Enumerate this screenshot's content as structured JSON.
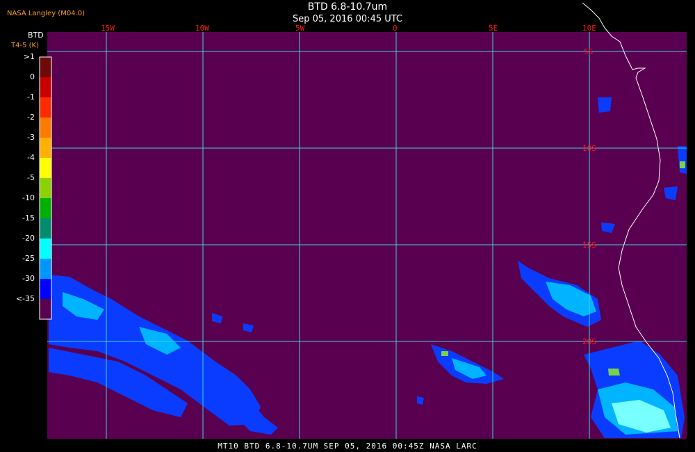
{
  "header": {
    "source": "NASA Langley (M04.0)",
    "title": "BTD 6.8-10.7um",
    "datetime": "Sep 05, 2016 00:45 UTC"
  },
  "legend": {
    "title": "BTD",
    "subtitle": "T4-5 (K)",
    "ticks": [
      ">1",
      "0",
      "-1",
      "-2",
      "-3",
      "-4",
      "-5",
      "-10",
      "-15",
      "-20",
      "-25",
      "-30",
      "<-35"
    ],
    "colors": [
      "#6e0a0a",
      "#c80000",
      "#ff2a00",
      "#ff7a00",
      "#ffb000",
      "#ffff00",
      "#8cd200",
      "#00b000",
      "#008c6e",
      "#00ffff",
      "#0096ff",
      "#0000ff",
      "#5a0050"
    ]
  },
  "map": {
    "background_color": "#5a0050",
    "grid_color": "#3fd0e0",
    "lon_labels": [
      "15W",
      "10W",
      "5W",
      "0",
      "5E",
      "10E"
    ],
    "lat_labels": [
      "5S",
      "10S",
      "15S",
      "20S"
    ],
    "label_color": "#ff1a1a"
  },
  "footer": {
    "text": "MT10  BTD 6.8-10.7UM   SEP 05, 2016 00:45Z   NASA LARC"
  }
}
